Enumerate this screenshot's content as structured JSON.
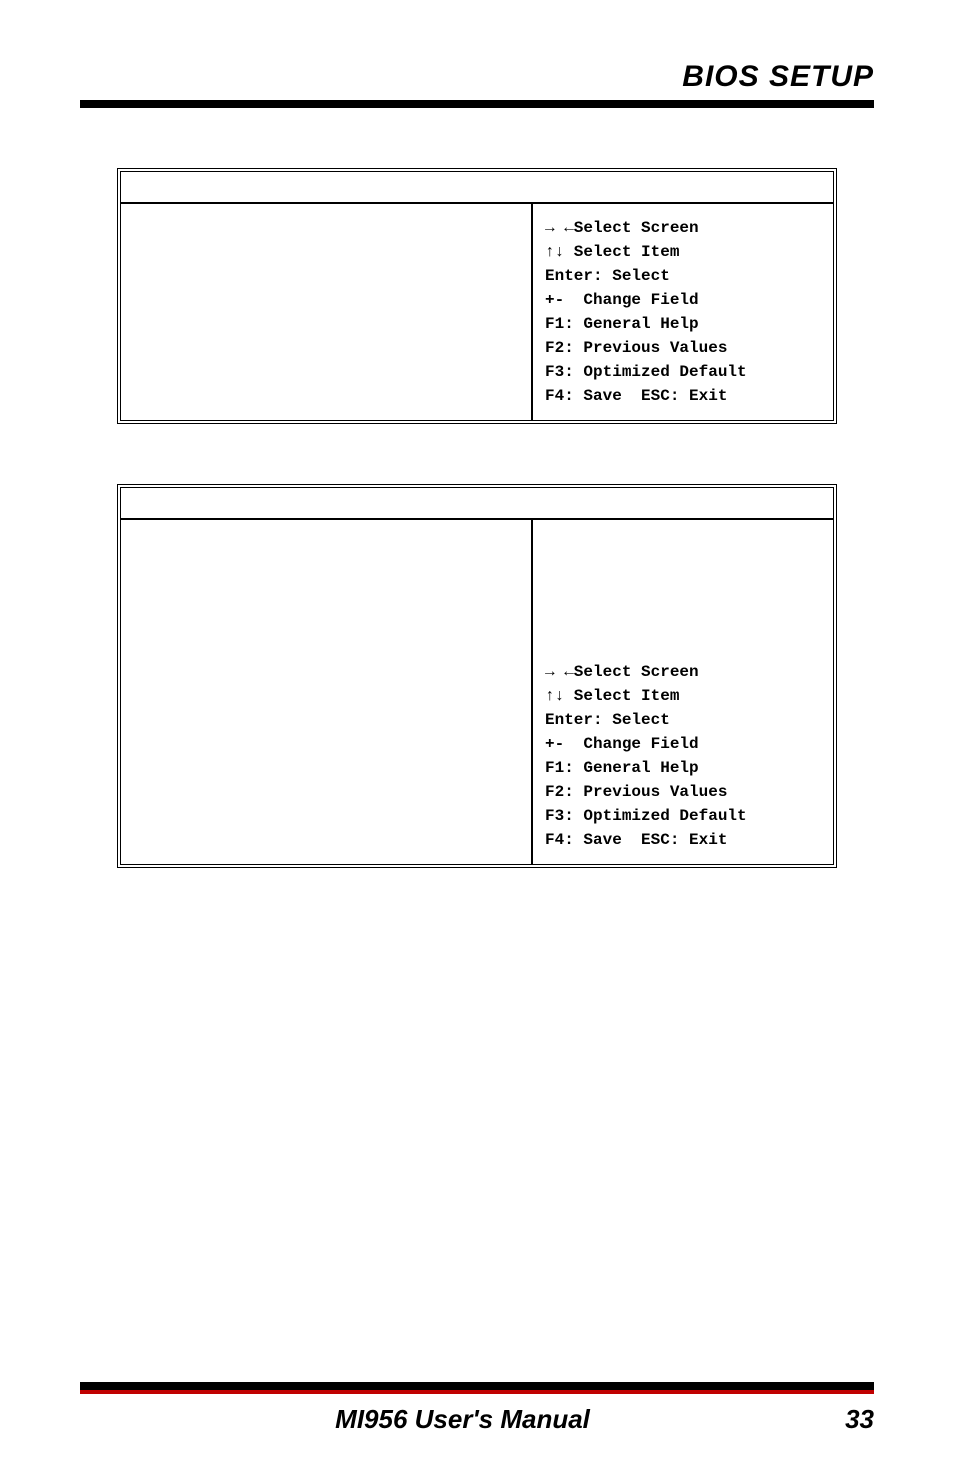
{
  "header": {
    "title": "BIOS SETUP"
  },
  "box1": {
    "help": {
      "l1": "→ ←Select Screen",
      "l2": "↑↓ Select Item",
      "l3": "Enter: Select",
      "l4": "+-  Change Field",
      "l5": "F1: General Help",
      "l6": "F2: Previous Values",
      "l7": "F3: Optimized Default",
      "l8": "F4: Save  ESC: Exit"
    }
  },
  "box2": {
    "help": {
      "l1": "→ ←Select Screen",
      "l2": "↑↓ Select Item",
      "l3": "Enter: Select",
      "l4": "+-  Change Field",
      "l5": "F1: General Help",
      "l6": "F2: Previous Values",
      "l7": "F3: Optimized Default",
      "l8": "F4: Save  ESC: Exit"
    }
  },
  "footer": {
    "title": "MI956 User's Manual",
    "page": "33"
  }
}
